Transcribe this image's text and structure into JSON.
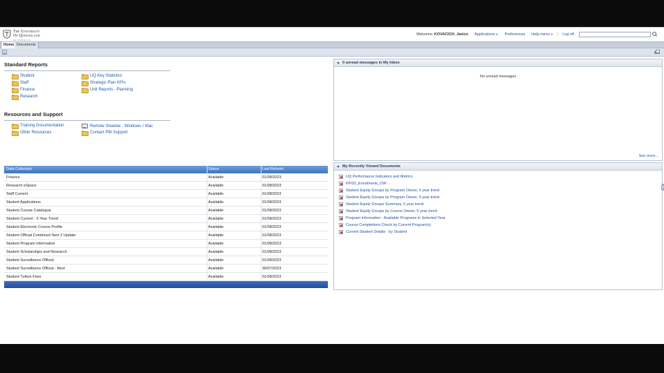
{
  "header": {
    "logo": {
      "line1": "The University",
      "line2": "Of Queensland",
      "line3": "AUSTRALIA"
    },
    "welcome_prefix": "Welcome:",
    "user_name": "KOVACICH, Janice",
    "nav": {
      "applications": "Applications",
      "preferences": "Preferences",
      "help_menu": "Help menu",
      "logoff": "Log off",
      "separator": "|"
    }
  },
  "tabs": [
    "Home",
    "Documents"
  ],
  "standard_reports": {
    "title": "Standard Reports",
    "left": [
      "Student",
      "Staff",
      "Finance",
      "Research"
    ],
    "right": [
      "UQ Key Statistics",
      "Strategic Plan KPIs",
      "Unit Reports - Planning"
    ]
  },
  "resources": {
    "title": "Resources and Support",
    "training": "Training Documentation",
    "other": "Other Resources",
    "remote_prefix": "Remote Shadow - Windows",
    "remote_sep": "/",
    "remote_mac": "Mac",
    "contact": "Contact PBI Support"
  },
  "data_table": {
    "headers": [
      "Data Collection",
      "Status",
      "Last Refresh"
    ],
    "rows": [
      [
        "Finance",
        "Available",
        "01/08/2023"
      ],
      [
        "Research eSpace",
        "Available",
        "01/08/2023"
      ],
      [
        "Staff Current",
        "Available",
        "01/08/2023"
      ],
      [
        "Student Applications",
        "Available",
        "01/08/2023"
      ],
      [
        "Student Course Catalogue",
        "Available",
        "01/08/2023"
      ],
      [
        "Student Current - 5 Year Trend",
        "Available",
        "01/08/2023"
      ],
      [
        "Student Electronic Course Profile",
        "Available",
        "01/08/2023"
      ],
      [
        "Student Official Combined Sem 2 Update",
        "Available",
        "01/08/2023"
      ],
      [
        "Student Program Information",
        "Available",
        "01/08/2023"
      ],
      [
        "Student Scholarships and Research",
        "Available",
        "01/08/2023"
      ],
      [
        "Student Surveillance Official",
        "Available",
        "01/08/2023"
      ],
      [
        "Student Surveillance Official - Next",
        "Available",
        "30/07/2023"
      ],
      [
        "Student Tuition Fees",
        "Available",
        "01/08/2023"
      ]
    ]
  },
  "inbox": {
    "title": "0 unread messages in My Inbox",
    "empty": "No unread messages",
    "see_more": "See more..."
  },
  "recent": {
    "title": "My Recently Viewed Documents",
    "items": [
      "UQ Performance Indicators and Metrics",
      "KPI22_Enrolments_OW",
      "Student Equity Groups by Program Owner, 5 year trend",
      "Student Equity Groups by Program Owner, 5 year trend",
      "Student Equity Groups Summary, 5 year trend",
      "Student Equity Groups by Course Owner, 5 year trend",
      "Program Information - Available Programs in Selected Year",
      "Course Completions Check by Current Program(s)",
      "Current Student Details - by Student"
    ]
  }
}
